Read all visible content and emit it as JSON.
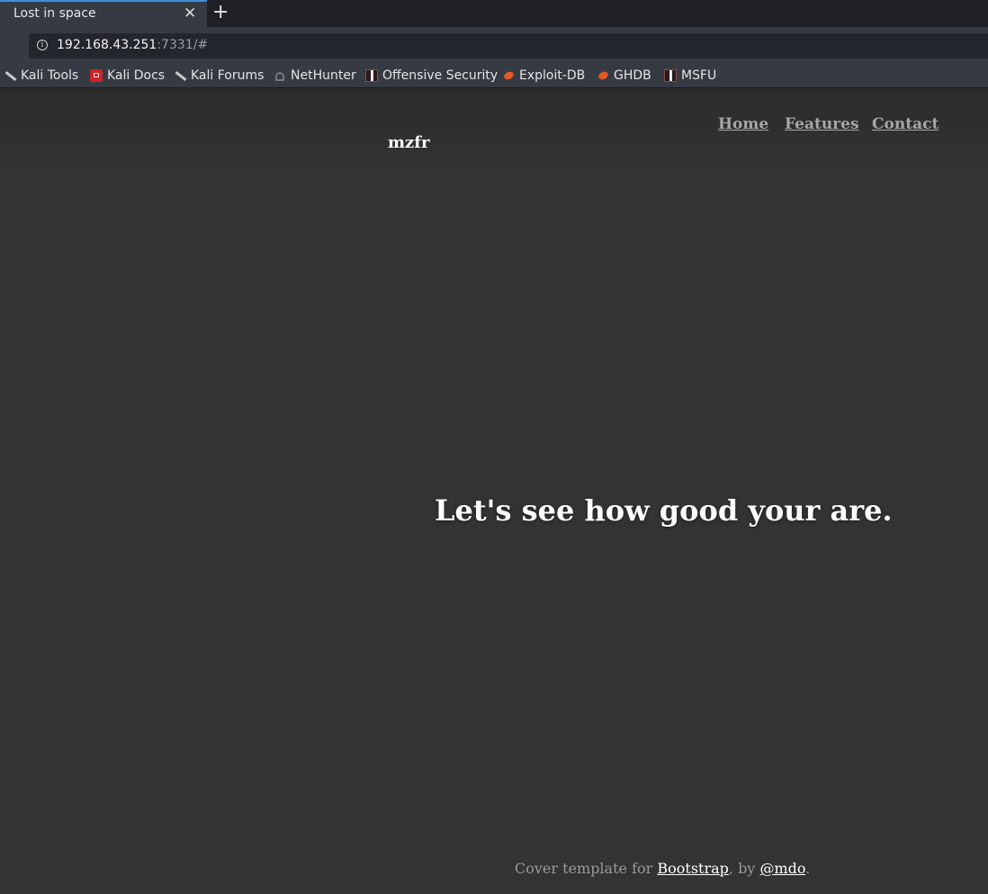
{
  "browser": {
    "tab_title": "Lost in space",
    "close_glyph": "✕",
    "new_tab_glyph": "+",
    "url_host": "192.168.43.251",
    "url_rest": ":7331/#",
    "bookmarks": [
      {
        "label": "Kali Tools",
        "icon": "kali-dragon-icon"
      },
      {
        "label": "Kali Docs",
        "icon": "kali-docs-icon"
      },
      {
        "label": "Kali Forums",
        "icon": "kali-dragon-icon"
      },
      {
        "label": "NetHunter",
        "icon": "nethunter-icon"
      },
      {
        "label": "Offensive Security",
        "icon": "offsec-icon"
      },
      {
        "label": "Exploit-DB",
        "icon": "exploit-db-icon"
      },
      {
        "label": "GHDB",
        "icon": "exploit-db-icon"
      },
      {
        "label": "MSFU",
        "icon": "offsec-icon"
      }
    ]
  },
  "page": {
    "brand": "mzfr",
    "nav": [
      "Home",
      "Features",
      "Contact"
    ],
    "lead": "Let's see how good your are.",
    "footer": {
      "prefix": "Cover template for ",
      "link1": "Bootstrap",
      "middle": ", by ",
      "link2": "@mdo",
      "suffix": "."
    }
  },
  "colors": {
    "background": "#333333",
    "chrome_dark": "#1f2126",
    "chrome": "#363a43",
    "tab_accent": "#3d8fe0",
    "nav_link": "#a6a6a6",
    "text": "#ffffff"
  }
}
